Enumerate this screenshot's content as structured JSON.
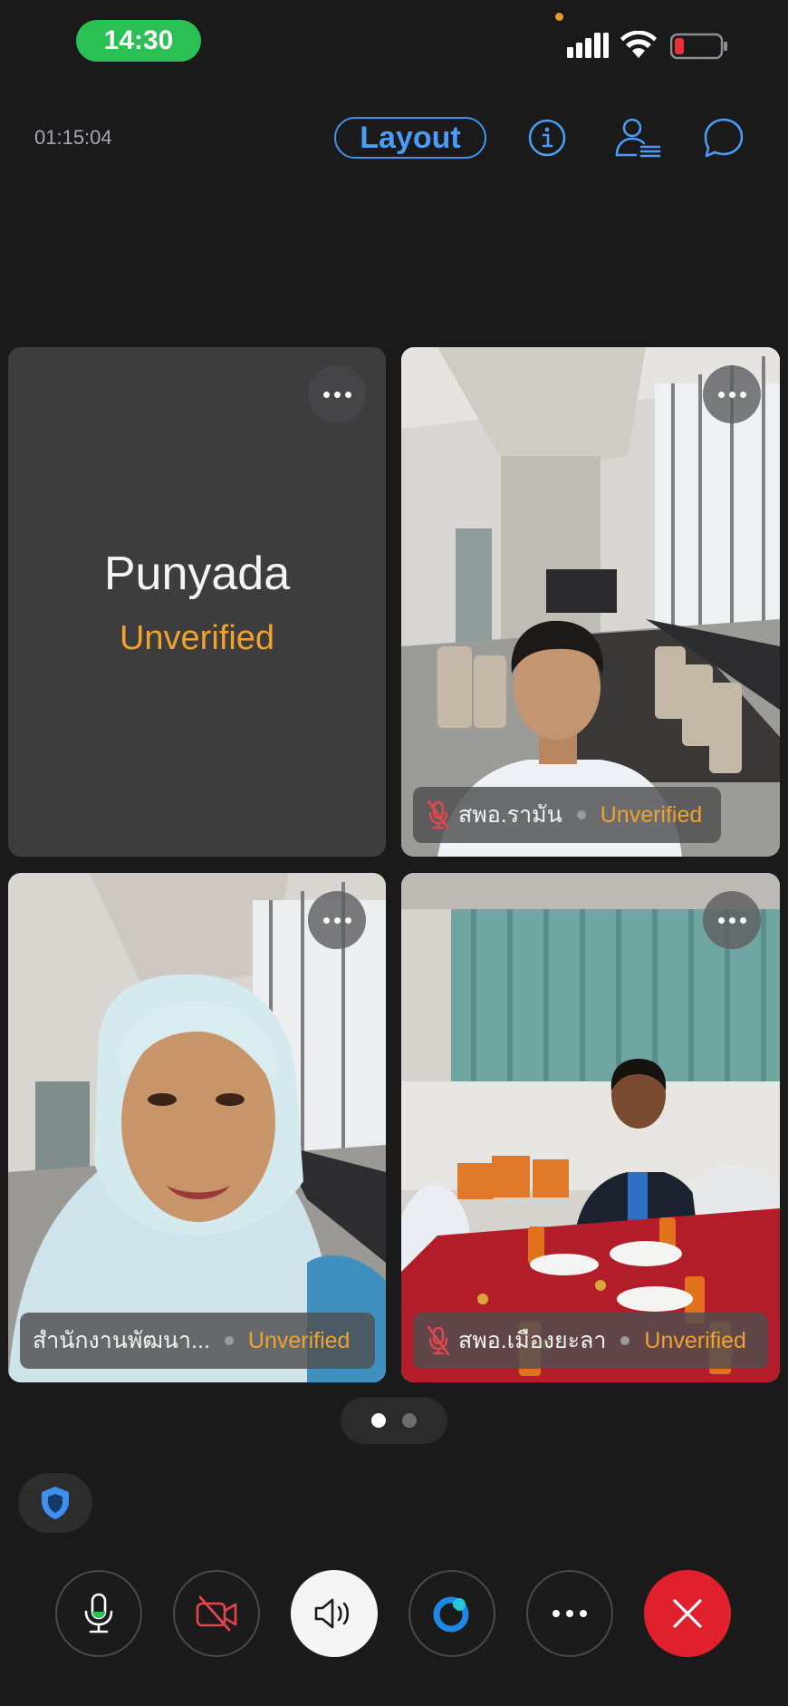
{
  "status_bar": {
    "time": "14:30"
  },
  "header": {
    "call_duration": "01:15:04",
    "layout_label": "Layout"
  },
  "tiles": [
    {
      "name": "Punyada",
      "verification": "Unverified",
      "video": false,
      "muted": false
    },
    {
      "name": "สพอ.รามัน",
      "verification": "Unverified",
      "video": true,
      "muted": true
    },
    {
      "name": "สำนักงานพัฒนา...",
      "verification": "Unverified",
      "video": true,
      "muted": false
    },
    {
      "name": "สพอ.เมืองยะลา",
      "verification": "Unverified",
      "video": true,
      "muted": true
    }
  ],
  "pagination": {
    "current_page": 1,
    "total_pages": 2
  },
  "controls": [
    {
      "icon": "microphone-icon"
    },
    {
      "icon": "camera-off-icon"
    },
    {
      "icon": "speaker-icon"
    },
    {
      "icon": "copilot-icon"
    },
    {
      "icon": "more-icon"
    },
    {
      "icon": "end-call-icon"
    }
  ],
  "colors": {
    "accent_blue": "#3f8ff0",
    "unverified_orange": "#f0a22e",
    "end_call_red": "#e0202d",
    "status_green": "#2ac054",
    "muted_red": "#e4454f"
  }
}
